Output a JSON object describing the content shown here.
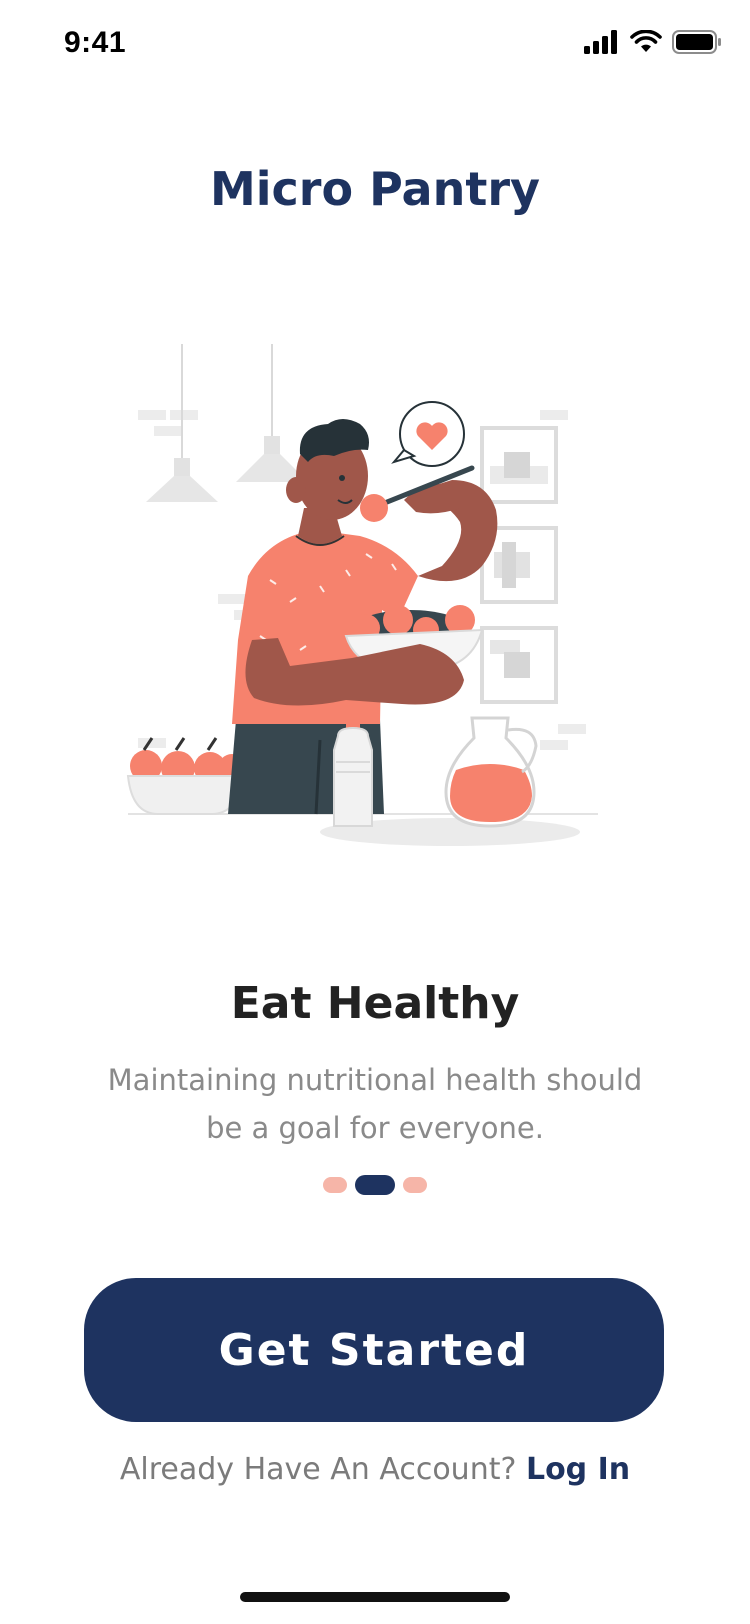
{
  "status_bar": {
    "time": "9:41",
    "icons": [
      "cellular-signal-icon",
      "wifi-icon",
      "battery-icon"
    ]
  },
  "app": {
    "title": "Micro Pantry"
  },
  "onboarding": {
    "headline": "Eat Healthy",
    "description": "Maintaining nutritional health should be a goal for everyone.",
    "page_count": 3,
    "active_page": 2
  },
  "actions": {
    "primary_label": "Get Started",
    "secondary_prompt": "Already Have An Account?",
    "secondary_link": "Log In"
  },
  "colors": {
    "brand_navy": "#1e3360",
    "accent_coral": "#f6826d",
    "dot_inactive": "#f6b5a8"
  }
}
